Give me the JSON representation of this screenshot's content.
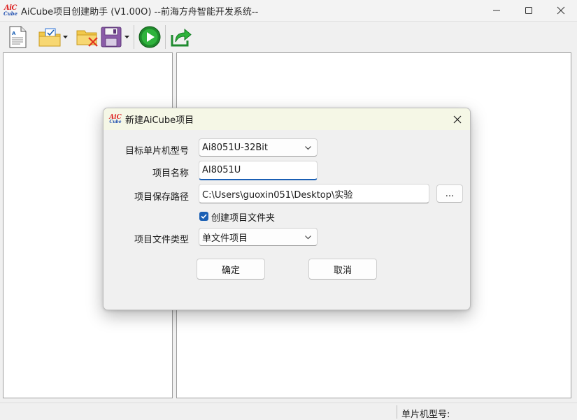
{
  "window": {
    "logo_top": "AiC",
    "logo_bottom": "Cube",
    "title": "AiCube项目创建助手 (V1.00O) --前海方舟智能开发系统--"
  },
  "toolbar": {
    "icons": [
      "new-file-icon",
      "open-project-icon",
      "close-project-icon",
      "save-icon",
      "run-icon",
      "export-icon"
    ]
  },
  "status_bar": {
    "mcu_label": "单片机型号:"
  },
  "dialog": {
    "logo_top": "AiC",
    "logo_bottom": "Cube",
    "title": "新建AiCube项目",
    "mcu_model_label": "目标单片机型号",
    "mcu_model_value": "Ai8051U-32Bit",
    "project_name_label": "项目名称",
    "project_name_value": "AI8051U",
    "save_path_label": "项目保存路径",
    "save_path_value": "C:\\Users\\guoxin051\\Desktop\\实验",
    "browse_label": "...",
    "create_folder_label": "创建项目文件夹",
    "create_folder_checked": true,
    "file_type_label": "项目文件类型",
    "file_type_value": "单文件项目",
    "ok_label": "确定",
    "cancel_label": "取消",
    "accent_color": "#1a5fb4"
  }
}
